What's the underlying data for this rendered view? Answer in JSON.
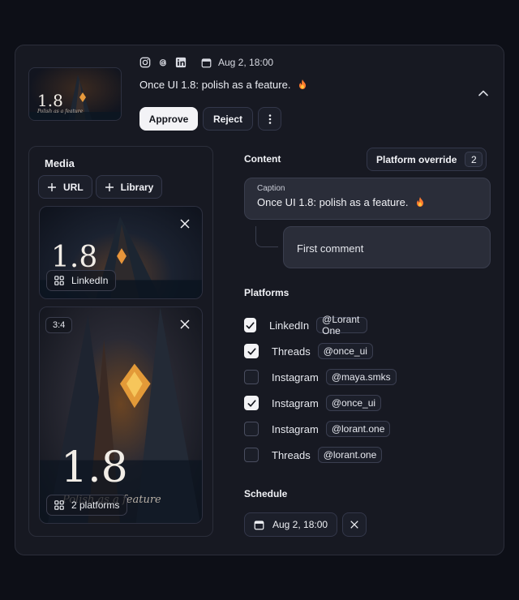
{
  "header": {
    "social_icons": [
      "instagram-icon",
      "threads-icon",
      "linkedin-icon"
    ],
    "date": "Aug 2, 18:00",
    "title": "Once UI 1.8: polish as a feature.",
    "thumb_number": "1.8",
    "thumb_subtitle": "Polish as a feature",
    "approve_label": "Approve",
    "reject_label": "Reject"
  },
  "media": {
    "title": "Media",
    "url_label": "URL",
    "library_label": "Library",
    "tiles": [
      {
        "number": "1.8",
        "chip": "LinkedIn"
      },
      {
        "ratio": "3:4",
        "number": "1.8",
        "subtitle": "Polish as a feature",
        "chip": "2 platforms"
      }
    ]
  },
  "content": {
    "title": "Content",
    "override_label": "Platform override",
    "override_count": "2",
    "caption_label": "Caption",
    "caption_value": "Once UI 1.8: polish as a feature.",
    "comment_placeholder": "First comment"
  },
  "platforms": {
    "title": "Platforms",
    "items": [
      {
        "name": "LinkedIn",
        "handle": "@Lorant One",
        "checked": true
      },
      {
        "name": "Threads",
        "handle": "@once_ui",
        "checked": true
      },
      {
        "name": "Instagram",
        "handle": "@maya.smks",
        "checked": false
      },
      {
        "name": "Instagram",
        "handle": "@once_ui",
        "checked": true
      },
      {
        "name": "Instagram",
        "handle": "@lorant.one",
        "checked": false
      },
      {
        "name": "Threads",
        "handle": "@lorant.one",
        "checked": false
      }
    ]
  },
  "schedule": {
    "title": "Schedule",
    "date": "Aug 2, 18:00"
  },
  "colors": {
    "background": "#0d0f17",
    "card": "#171922",
    "accent_light": "#f3f3f6",
    "flame": "#ff7a2f"
  }
}
